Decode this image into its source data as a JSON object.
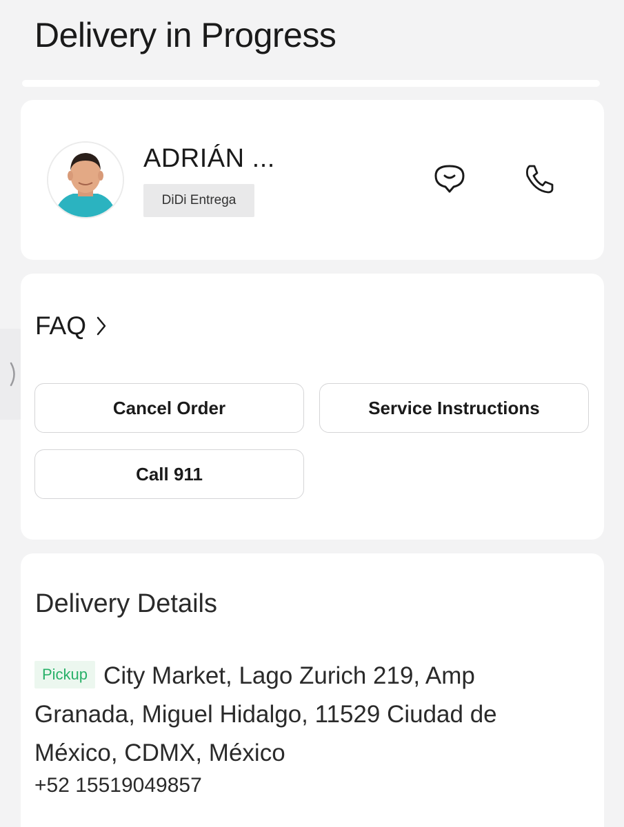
{
  "header": {
    "title": "Delivery in Progress"
  },
  "driver": {
    "name": "ADRIÁN ...",
    "service": "DiDi Entrega",
    "avatar_icon": "driver-photo",
    "chat_icon": "chat-bubble-icon",
    "phone_icon": "phone-icon"
  },
  "actions": {
    "faq_label": "FAQ",
    "cancel_label": "Cancel Order",
    "instructions_label": "Service Instructions",
    "call911_label": "Call 911"
  },
  "delivery_details": {
    "title": "Delivery Details",
    "pickup_tag": "Pickup",
    "pickup_address": "City Market, Lago Zurich 219, Amp Granada, Miguel Hidalgo, 11529 Ciudad de México, CDMX, México",
    "phone": "+52 15519049857"
  },
  "colors": {
    "background": "#f3f3f4",
    "card": "#ffffff",
    "pickup_text": "#28b068",
    "pickup_bg": "#ecf7ef"
  }
}
